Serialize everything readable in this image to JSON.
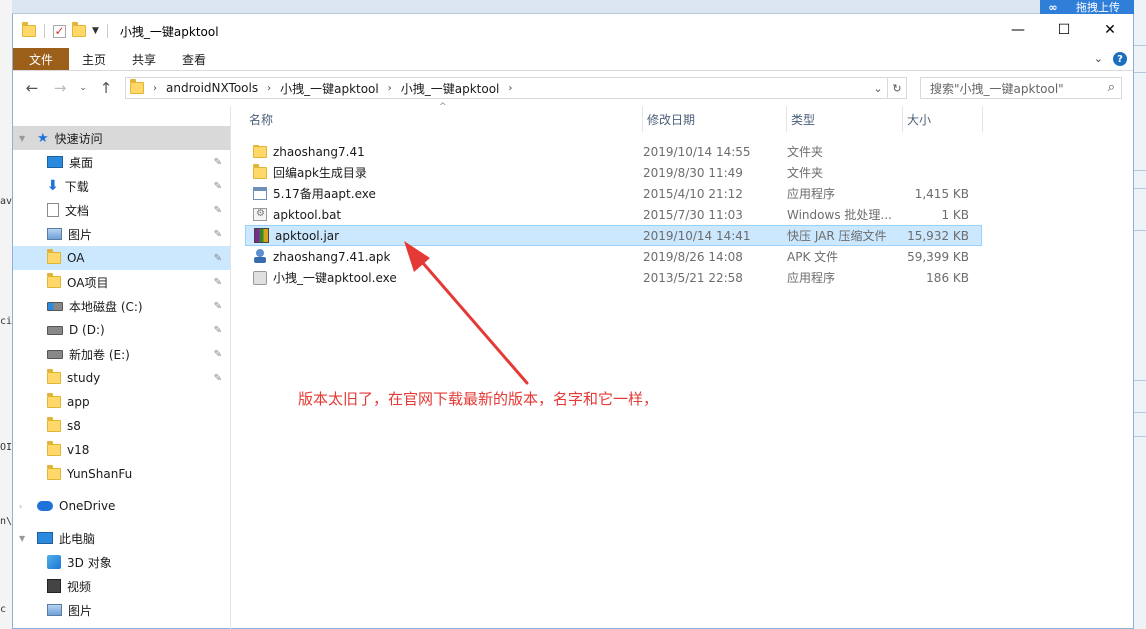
{
  "background": {
    "left_fragments": [
      "av",
      "ci",
      "OI",
      "n\\",
      "c"
    ],
    "badge_icon": "cloud-loop-icon",
    "badge_text": "拖拽上传"
  },
  "window": {
    "title": "小拽_一键apktool",
    "controls": {
      "minimize": "—",
      "maximize": "☐",
      "close": "✕"
    }
  },
  "ribbon": {
    "file_tab": "文件",
    "tabs": [
      "主页",
      "共享",
      "查看"
    ],
    "collapse": "⌄",
    "help": "?"
  },
  "navigation": {
    "back": "←",
    "forward": "→",
    "recent": "⌄",
    "up": "↑",
    "breadcrumbs": [
      "androidNXTools",
      "小拽_一键apktool",
      "小拽_一键apktool"
    ],
    "search_placeholder": "搜索\"小拽_一键apktool\""
  },
  "sidebar": {
    "quick_access": "快速访问",
    "items": [
      {
        "label": "桌面",
        "icon": "desktop-icon",
        "pinned": true
      },
      {
        "label": "下载",
        "icon": "download-icon",
        "pinned": true
      },
      {
        "label": "文档",
        "icon": "document-icon",
        "pinned": true
      },
      {
        "label": "图片",
        "icon": "pictures-icon",
        "pinned": true
      },
      {
        "label": "OA",
        "icon": "folder-icon",
        "pinned": true,
        "selected": true
      },
      {
        "label": "OA项目",
        "icon": "folder-icon",
        "pinned": true
      },
      {
        "label": "本地磁盘 (C:)",
        "icon": "drive-icon",
        "pinned": true
      },
      {
        "label": "D (D:)",
        "icon": "drive-icon",
        "pinned": true
      },
      {
        "label": "新加卷 (E:)",
        "icon": "drive-icon",
        "pinned": true
      },
      {
        "label": "study",
        "icon": "folder-icon",
        "pinned": true
      },
      {
        "label": "app",
        "icon": "folder-icon",
        "pinned": false
      },
      {
        "label": "s8",
        "icon": "folder-icon",
        "pinned": false
      },
      {
        "label": "v18",
        "icon": "folder-icon",
        "pinned": false
      },
      {
        "label": "YunShanFu",
        "icon": "folder-icon",
        "pinned": false
      }
    ],
    "onedrive": "OneDrive",
    "this_pc": "此电脑",
    "pc_items": [
      {
        "label": "3D 对象",
        "icon": "3d-objects-icon"
      },
      {
        "label": "视频",
        "icon": "video-icon"
      },
      {
        "label": "图片",
        "icon": "pictures-icon"
      }
    ],
    "pin_glyph": "📌"
  },
  "columns": {
    "name": "名称",
    "date": "修改日期",
    "type": "类型",
    "size": "大小"
  },
  "files": [
    {
      "name": "zhaoshang7.41",
      "date": "2019/10/14 14:55",
      "type": "文件夹",
      "size": "",
      "icon": "folder-icon"
    },
    {
      "name": "回编apk生成目录",
      "date": "2019/8/30 11:49",
      "type": "文件夹",
      "size": "",
      "icon": "folder-icon"
    },
    {
      "name": "5.17备用aapt.exe",
      "date": "2015/4/10 21:12",
      "type": "应用程序",
      "size": "1,415 KB",
      "icon": "exe-icon"
    },
    {
      "name": "apktool.bat",
      "date": "2015/7/30 11:03",
      "type": "Windows 批处理...",
      "size": "1 KB",
      "icon": "batch-file-icon"
    },
    {
      "name": "apktool.jar",
      "date": "2019/10/14 14:41",
      "type": "快压 JAR 压缩文件",
      "size": "15,932 KB",
      "icon": "jar-archive-icon",
      "selected": true
    },
    {
      "name": "zhaoshang7.41.apk",
      "date": "2019/8/26 14:08",
      "type": "APK 文件",
      "size": "59,399 KB",
      "icon": "apk-icon"
    },
    {
      "name": "小拽_一键apktool.exe",
      "date": "2013/5/21 22:58",
      "type": "应用程序",
      "size": "186 KB",
      "icon": "exe-icon"
    }
  ],
  "annotation": {
    "text": "版本太旧了，在官网下载最新的版本，名字和它一样，",
    "color": "#e53935"
  }
}
